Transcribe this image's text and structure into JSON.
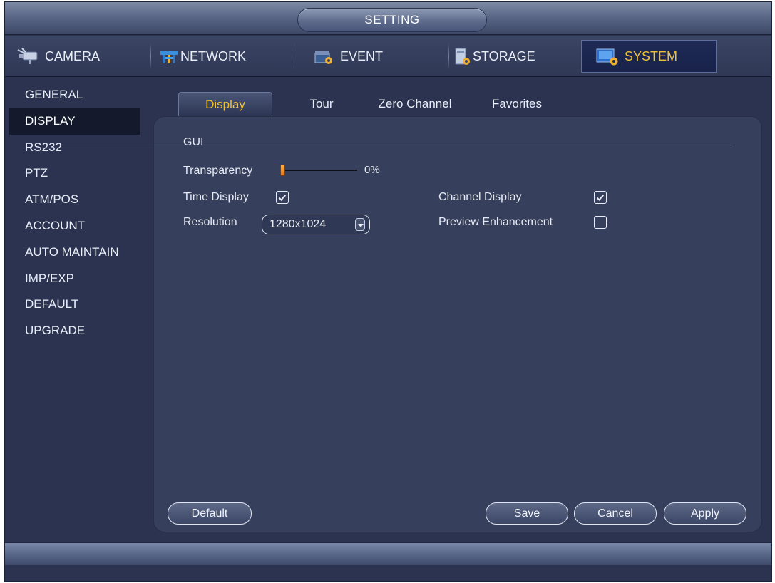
{
  "window": {
    "title": "SETTING"
  },
  "menu": {
    "tabs": [
      {
        "label": "CAMERA",
        "icon": "camera-icon"
      },
      {
        "label": "NETWORK",
        "icon": "network-icon"
      },
      {
        "label": "EVENT",
        "icon": "event-icon"
      },
      {
        "label": "STORAGE",
        "icon": "storage-icon"
      },
      {
        "label": "SYSTEM",
        "icon": "system-icon",
        "active": true
      }
    ]
  },
  "sidebar": {
    "items": [
      {
        "label": "GENERAL"
      },
      {
        "label": "DISPLAY",
        "active": true
      },
      {
        "label": "RS232"
      },
      {
        "label": "PTZ"
      },
      {
        "label": "ATM/POS"
      },
      {
        "label": "ACCOUNT"
      },
      {
        "label": "AUTO MAINTAIN"
      },
      {
        "label": "IMP/EXP"
      },
      {
        "label": "DEFAULT"
      },
      {
        "label": "UPGRADE"
      }
    ]
  },
  "subtabs": [
    {
      "label": "Display",
      "active": true
    },
    {
      "label": "Tour"
    },
    {
      "label": "Zero Channel"
    },
    {
      "label": "Favorites"
    }
  ],
  "display": {
    "section": "GUI",
    "transparency": {
      "label": "Transparency",
      "value": 0,
      "value_text": "0%"
    },
    "time_display": {
      "label": "Time Display",
      "checked": true
    },
    "channel_display": {
      "label": "Channel Display",
      "checked": true
    },
    "resolution": {
      "label": "Resolution",
      "value": "1280x1024"
    },
    "preview_enhancement": {
      "label": "Preview Enhancement",
      "checked": false
    }
  },
  "buttons": {
    "default": "Default",
    "save": "Save",
    "cancel": "Cancel",
    "apply": "Apply"
  },
  "colors": {
    "accent": "#f0c233",
    "background": "#2b3350",
    "panel": "#363f5c",
    "slider_thumb": "#f0902a"
  }
}
